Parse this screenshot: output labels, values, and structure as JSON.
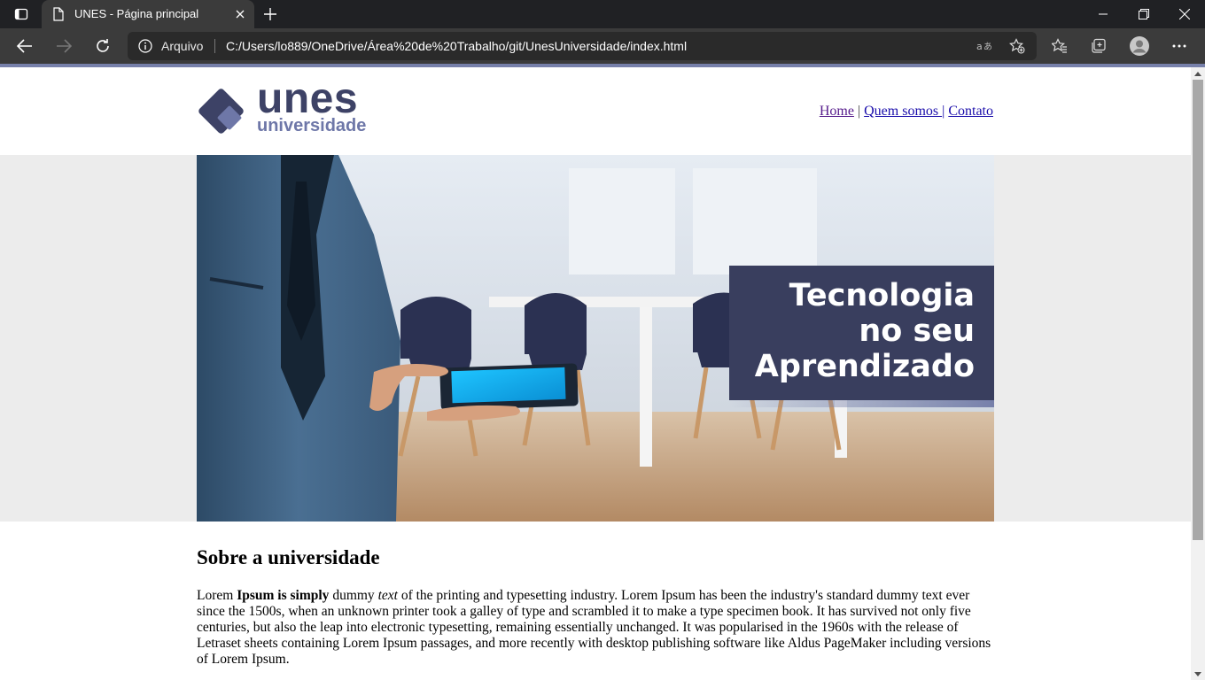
{
  "browser": {
    "tab_title": "UNES - Página principal",
    "address_label": "Arquivo",
    "url": "C:/Users/lo889/OneDrive/Área%20de%20Trabalho/git/UnesUniversidade/index.html"
  },
  "site": {
    "logo": {
      "word": "unes",
      "subword": "universidade",
      "colors": {
        "dark": "#3d4266",
        "light": "#6e77a8"
      }
    },
    "nav": {
      "home": "Home",
      "sep1": " | ",
      "about": "Quem somos ",
      "sep2": "| ",
      "contact": "Contato"
    },
    "hero": {
      "line1": "Tecnologia",
      "line2": "no seu",
      "line3": "Aprendizado",
      "box_color": "#393e5e"
    },
    "about": {
      "title": "Sobre a universidade",
      "p_lead": "Lorem ",
      "p_bold": "Ipsum is simply",
      "p_mid": " dummy ",
      "p_italic": "text",
      "p_rest": " of the printing and typesetting industry. Lorem Ipsum has been the industry's standard dummy text ever since the 1500s, when an unknown printer took a galley of type and scrambled it to make a type specimen book. It has survived not only five centuries, but also the leap into electronic typesetting, remaining essentially unchanged. It was popularised in the 1960s with the release of Letraset sheets containing Lorem Ipsum passages, and more recently with desktop publishing software like Aldus PageMaker including versions of Lorem Ipsum."
    }
  }
}
